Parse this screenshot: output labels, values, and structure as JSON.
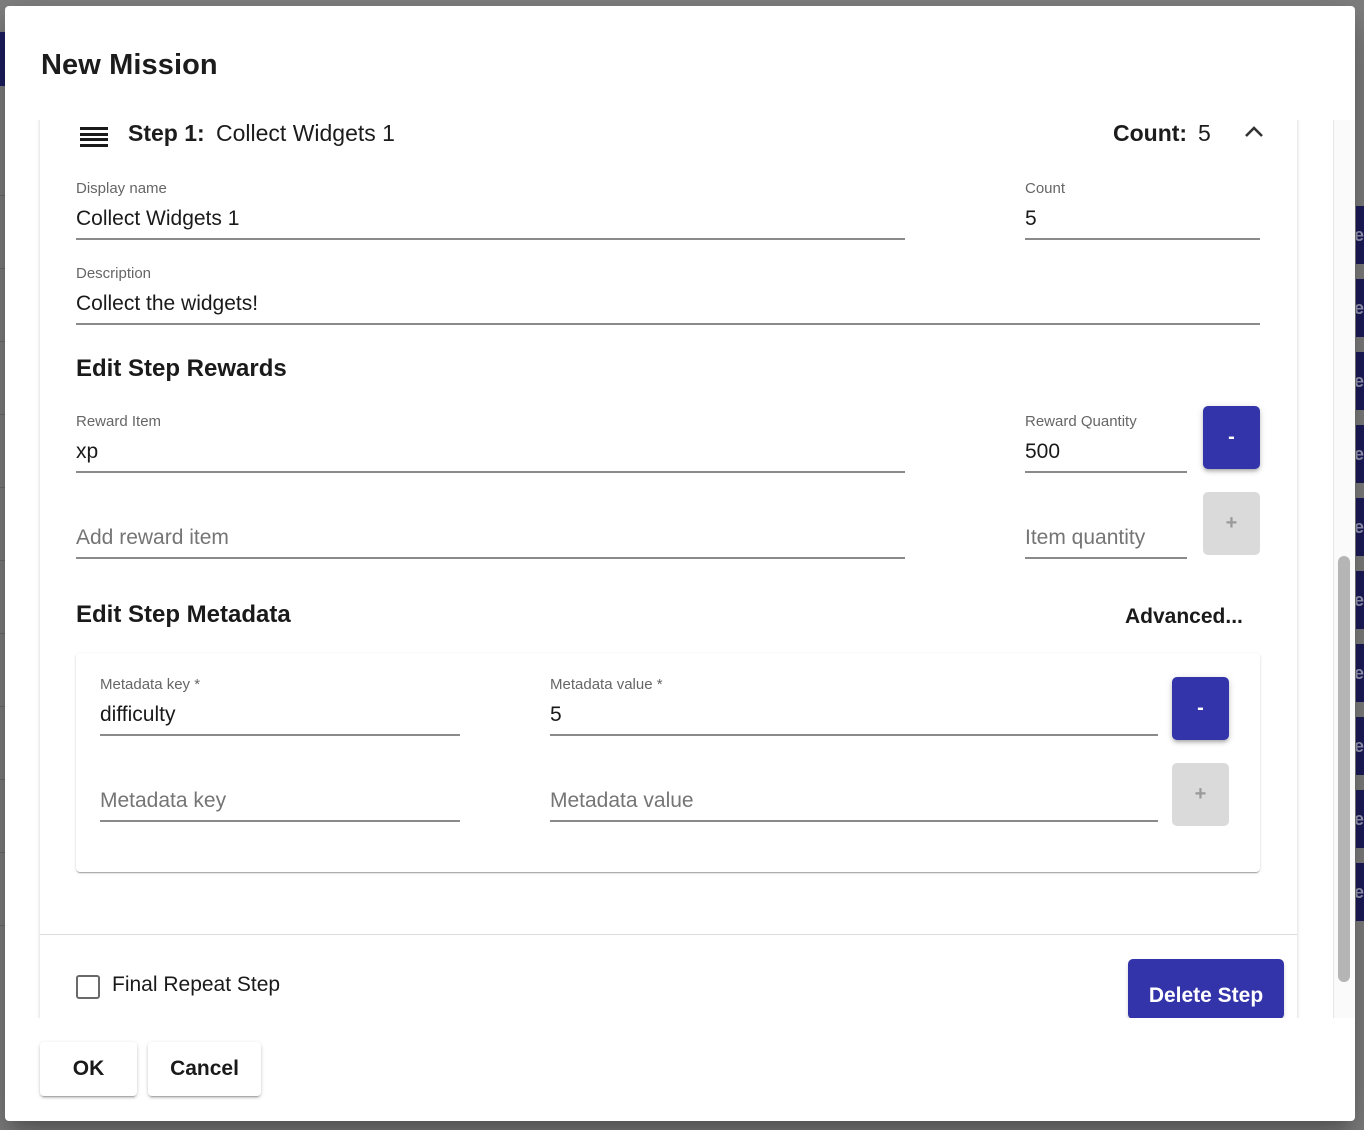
{
  "dialog": {
    "title": "New Mission"
  },
  "step": {
    "label": "Step 1:",
    "name": "Collect Widgets 1",
    "count_label": "Count:",
    "count_value": "5",
    "fields": {
      "display_name": {
        "label": "Display name",
        "value": "Collect Widgets 1"
      },
      "count": {
        "label": "Count",
        "value": "5"
      },
      "description": {
        "label": "Description",
        "value": "Collect the widgets!"
      }
    },
    "rewards": {
      "title": "Edit Step Rewards",
      "items": [
        {
          "item_label": "Reward Item",
          "item_value": "xp",
          "quantity_label": "Reward Quantity",
          "quantity_value": "500",
          "remove_label": "-"
        }
      ],
      "new_item": {
        "item_placeholder": "Add reward item",
        "quantity_placeholder": "Item quantity",
        "add_label": "+"
      }
    },
    "metadata": {
      "title": "Edit Step Metadata",
      "advanced_label": "Advanced...",
      "entries": [
        {
          "key_label": "Metadata key *",
          "key_value": "difficulty",
          "value_label": "Metadata value *",
          "value_value": "5",
          "remove_label": "-"
        }
      ],
      "new_entry": {
        "key_placeholder": "Metadata key",
        "value_placeholder": "Metadata value",
        "add_label": "+"
      }
    },
    "final_repeat": {
      "label": "Final Repeat Step",
      "checked": false
    },
    "delete_label": "Delete Step"
  },
  "actions": {
    "ok_label": "OK",
    "cancel_label": "Cancel"
  },
  "backdrop": {
    "button_glyph": "e"
  },
  "colors": {
    "primary": "#3333aa",
    "disabled": "#dadada",
    "backdrop": "#808080"
  },
  "icons": {
    "drag": "drag-handle-icon",
    "collapse": "chevron-up-icon"
  }
}
